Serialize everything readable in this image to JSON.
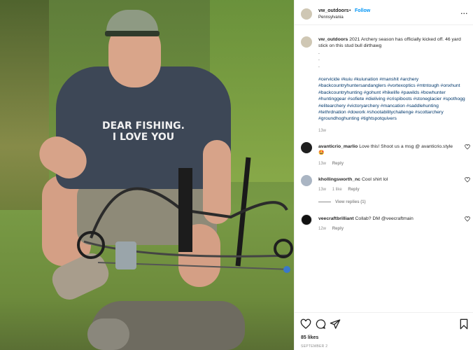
{
  "post": {
    "username": "vw_outdoors",
    "follow_label": "Follow",
    "location": "Pennsylvania",
    "more_label": "...",
    "shirt_text": [
      "DEAR FISHING.",
      "I LOVE YOU"
    ]
  },
  "caption": {
    "username": "vw_outdoors",
    "text": "2021 Archery season has officially kicked off. 46 yard stick on this stud bull dirthawg",
    "dots": [
      ".",
      ".",
      "."
    ],
    "hashtags": "#cervicide #kuiu #kuiunation #manshit #archery #backcountryhuntersandanglers #vortexoptics #mtntough #onxhunt #backcountryhunting #gohunt #hikelife #pawilds #bowhunter #huntinggear #sofiete #dieliving #crispiboots #stoneglacier #spothogg #elitearchery #victoryarchery #mancation #saddlehunting #tethrdnation #dowork #shootabilitychallenge #scottarchery #groundhoghunting #tightspotquivers",
    "time": "13w"
  },
  "comments": [
    {
      "username": "avanticrio_marlio",
      "text": "Love this! Shoot us a msg @ avanticrio.style 🤩",
      "time": "13w",
      "likes": "",
      "reply_label": "Reply"
    },
    {
      "username": "khollingsworth_nc",
      "text": "Cool shirt lol",
      "time": "13w",
      "likes": "1 like",
      "reply_label": "Reply"
    },
    {
      "username": "veecraftbrilliant",
      "text": "Collab? DM @veecraftmain",
      "time": "12w",
      "likes": "",
      "reply_label": "Reply"
    }
  ],
  "view_replies_label": "View replies (1)",
  "footer": {
    "likes": "85 likes",
    "date": "SEPTEMBER 2"
  },
  "icons": {
    "like": "heart-icon",
    "comment": "comment-icon",
    "share": "share-icon",
    "save": "bookmark-icon"
  }
}
